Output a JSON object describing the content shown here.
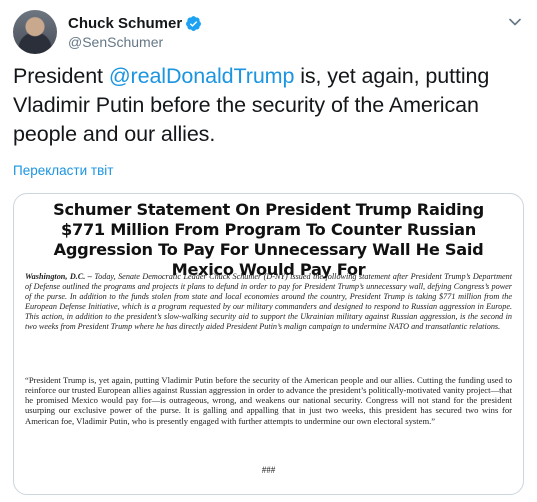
{
  "tweet": {
    "author": {
      "display_name": "Chuck Schumer",
      "handle": "@SenSchumer",
      "verified_icon": "verified-badge-icon",
      "avatar": "profile-photo"
    },
    "text": {
      "prefix": "President ",
      "mention": "@realDonaldTrump",
      "suffix": " is, yet again, putting Vladimir Putin before the security of the American people and our allies."
    },
    "translate_label": "Перекласти твіт",
    "menu_icon": "chevron-down-icon"
  },
  "document": {
    "title": "Schumer Statement On President Trump Raiding $771 Million From Program To Counter Russian Aggression To Pay For Unnecessary Wall He Said Mexico Would Pay For",
    "dateline": "Washington, D.C. –",
    "paragraph1": " Today, Senate Democratic Leader Chuck Schumer (D-NY) issued the following statement after President Trump’s Department of Defense outlined the programs and projects it plans to defund in order to pay for President Trump’s unnecessary wall, defying Congress’s power of the purse. In addition to the funds stolen from state and local economies around the country, President Trump is taking $771 million from the European Defense Initiative, which is a program requested by our military commanders and designed to respond to Russian aggression in Europe. This action, in addition to the president’s slow-walking security aid to support the Ukrainian military against Russian aggression, is the second in two weeks from President Trump where he has directly aided President Putin’s malign campaign to undermine NATO and transatlantic relations.",
    "paragraph2": "“President Trump is, yet again, putting Vladimir Putin before the security of the American people and our allies. Cutting the funding used to reinforce our trusted European allies against Russian aggression in order to advance the president’s politically-motivated vanity project—that he promised Mexico would pay for—is outrageous, wrong, and weakens our national security. Congress will not stand for the president usurping our exclusive power of the purse. It is galling and appalling that in just two weeks, this president has secured two wins for American foe, Vladimir Putin, who is presently engaged with further attempts to undermine our own electoral system.”",
    "end_mark": "###"
  },
  "colors": {
    "link": "#1b95e0",
    "secondary_text": "#657786",
    "border": "#ccd6dd"
  }
}
